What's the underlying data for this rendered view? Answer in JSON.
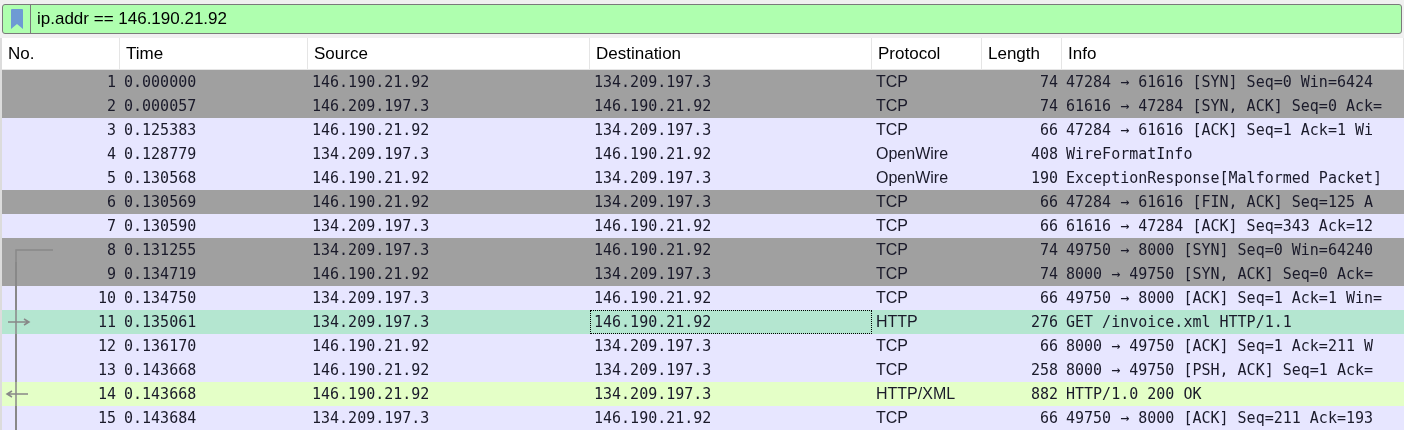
{
  "filter": {
    "value": "ip.addr == 146.190.21.92"
  },
  "table": {
    "columns": [
      "No.",
      "Time",
      "Source",
      "Destination",
      "Protocol",
      "Length",
      "Info"
    ],
    "rows": [
      {
        "no": "1",
        "time": "0.000000",
        "source": "146.190.21.92",
        "destination": "134.209.197.3",
        "protocol": "TCP",
        "length": "74",
        "info": "47284 → 61616 [SYN] Seq=0 Win=6424",
        "color": "#a0a0a0",
        "selected": false
      },
      {
        "no": "2",
        "time": "0.000057",
        "source": "146.209.197.3",
        "destination": "146.190.21.92",
        "protocol": "TCP",
        "length": "74",
        "info": "61616 → 47284 [SYN, ACK] Seq=0 Ack=",
        "color": "#a0a0a0",
        "selected": false
      },
      {
        "no": "3",
        "time": "0.125383",
        "source": "146.190.21.92",
        "destination": "134.209.197.3",
        "protocol": "TCP",
        "length": "66",
        "info": "47284 → 61616 [ACK] Seq=1 Ack=1 Wi",
        "color": "#e7e6ff",
        "selected": false
      },
      {
        "no": "4",
        "time": "0.128779",
        "source": "134.209.197.3",
        "destination": "146.190.21.92",
        "protocol": "OpenWire",
        "length": "408",
        "info": "WireFormatInfo",
        "color": "#e7e6ff",
        "selected": false
      },
      {
        "no": "5",
        "time": "0.130568",
        "source": "146.190.21.92",
        "destination": "134.209.197.3",
        "protocol": "OpenWire",
        "length": "190",
        "info": "ExceptionResponse[Malformed Packet]",
        "color": "#e7e6ff",
        "selected": false
      },
      {
        "no": "6",
        "time": "0.130569",
        "source": "146.190.21.92",
        "destination": "134.209.197.3",
        "protocol": "TCP",
        "length": "66",
        "info": "47284 → 61616 [FIN, ACK] Seq=125 A",
        "color": "#a0a0a0",
        "selected": false
      },
      {
        "no": "7",
        "time": "0.130590",
        "source": "134.209.197.3",
        "destination": "146.190.21.92",
        "protocol": "TCP",
        "length": "66",
        "info": "61616 → 47284 [ACK] Seq=343 Ack=12",
        "color": "#e7e6ff",
        "selected": false
      },
      {
        "no": "8",
        "time": "0.131255",
        "source": "134.209.197.3",
        "destination": "146.190.21.92",
        "protocol": "TCP",
        "length": "74",
        "info": "49750 → 8000 [SYN] Seq=0 Win=64240",
        "color": "#a0a0a0",
        "selected": false,
        "kind": "first"
      },
      {
        "no": "9",
        "time": "0.134719",
        "source": "146.190.21.92",
        "destination": "134.209.197.3",
        "protocol": "TCP",
        "length": "74",
        "info": "8000 → 49750 [SYN, ACK] Seq=0 Ack=",
        "color": "#a0a0a0",
        "selected": false,
        "kind": "middle"
      },
      {
        "no": "10",
        "time": "0.134750",
        "source": "134.209.197.3",
        "destination": "146.190.21.92",
        "protocol": "TCP",
        "length": "66",
        "info": "49750 → 8000 [ACK] Seq=1 Ack=1 Win=",
        "color": "#e7e6ff",
        "selected": false,
        "kind": "middle"
      },
      {
        "no": "11",
        "time": "0.135061",
        "source": "134.209.197.3",
        "destination": "146.190.21.92",
        "protocol": "HTTP",
        "length": "276",
        "info": "GET /invoice.xml HTTP/1.1",
        "color": "#b4e6d0",
        "selected": true,
        "kind": "request"
      },
      {
        "no": "12",
        "time": "0.136170",
        "source": "146.190.21.92",
        "destination": "134.209.197.3",
        "protocol": "TCP",
        "length": "66",
        "info": "8000 → 49750 [ACK] Seq=1 Ack=211 W",
        "color": "#e7e6ff",
        "selected": false,
        "kind": "middle"
      },
      {
        "no": "13",
        "time": "0.143668",
        "source": "146.190.21.92",
        "destination": "134.209.197.3",
        "protocol": "TCP",
        "length": "258",
        "info": "8000 → 49750 [PSH, ACK] Seq=1 Ack=",
        "color": "#e7e6ff",
        "selected": false,
        "kind": "middle"
      },
      {
        "no": "14",
        "time": "0.143668",
        "source": "146.190.21.92",
        "destination": "134.209.197.3",
        "protocol": "HTTP/XML",
        "length": "882",
        "info": "HTTP/1.0 200 OK",
        "color": "#e4ffc7",
        "selected": false,
        "kind": "response"
      },
      {
        "no": "15",
        "time": "0.143684",
        "source": "134.209.197.3",
        "destination": "146.190.21.92",
        "protocol": "TCP",
        "length": "66",
        "info": "49750 → 8000 [ACK] Seq=211 Ack=193",
        "color": "#e7e6ff",
        "selected": false,
        "kind": "middle"
      }
    ]
  }
}
